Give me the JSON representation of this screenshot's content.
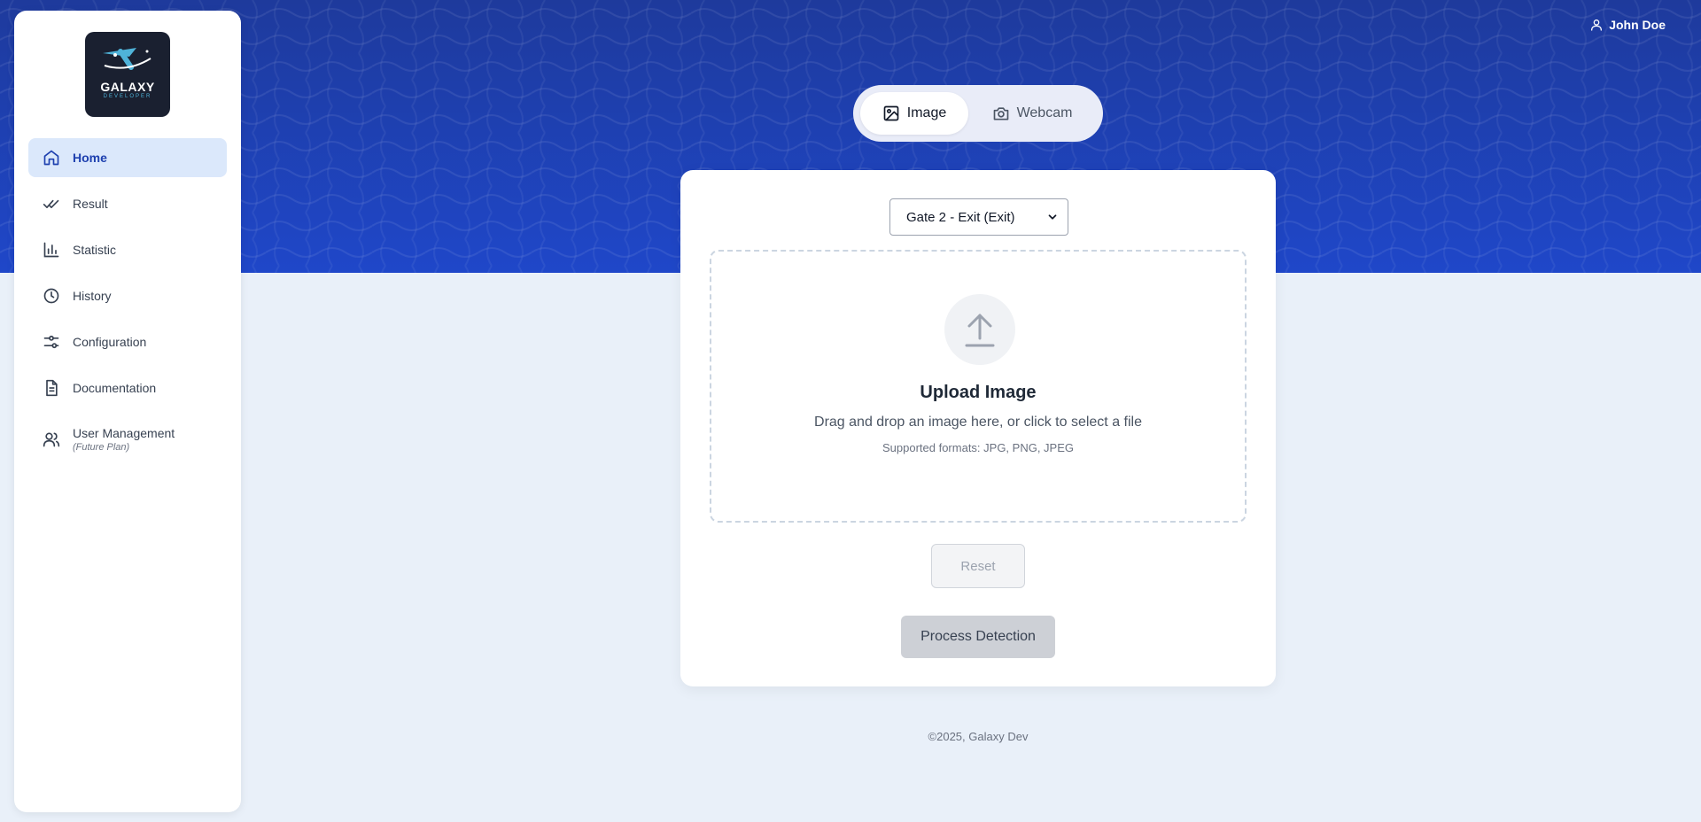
{
  "brand": {
    "logo_text": "GALAXY",
    "logo_subtext": "DEVELOPER"
  },
  "sidebar": {
    "items": [
      {
        "label": "Home",
        "icon": "home-icon",
        "active": true
      },
      {
        "label": "Result",
        "icon": "double-check-icon",
        "active": false
      },
      {
        "label": "Statistic",
        "icon": "bar-chart-icon",
        "active": false
      },
      {
        "label": "History",
        "icon": "clock-icon",
        "active": false
      },
      {
        "label": "Configuration",
        "icon": "sliders-icon",
        "active": false
      },
      {
        "label": "Documentation",
        "icon": "document-icon",
        "active": false
      },
      {
        "label": "User Management",
        "sublabel": "(Future Plan)",
        "icon": "users-icon",
        "active": false
      }
    ]
  },
  "header": {
    "user_name": "John Doe"
  },
  "mode_tabs": [
    {
      "label": "Image",
      "icon": "image-icon",
      "active": true
    },
    {
      "label": "Webcam",
      "icon": "camera-icon",
      "active": false
    }
  ],
  "main": {
    "gate_select": {
      "selected": "Gate 2 - Exit (Exit)"
    },
    "upload": {
      "title": "Upload Image",
      "description": "Drag and drop an image here, or click to select a file",
      "formats": "Supported formats: JPG, PNG, JPEG"
    },
    "reset_label": "Reset",
    "process_label": "Process Detection"
  },
  "footer": {
    "text": "©2025, Galaxy Dev"
  },
  "colors": {
    "hero_top": "#1e3a9c",
    "hero_bottom": "#1f47c9",
    "page_bg": "#e9f0f9",
    "active_nav_bg": "#dbe8fb",
    "active_nav_text": "#1e40af"
  }
}
